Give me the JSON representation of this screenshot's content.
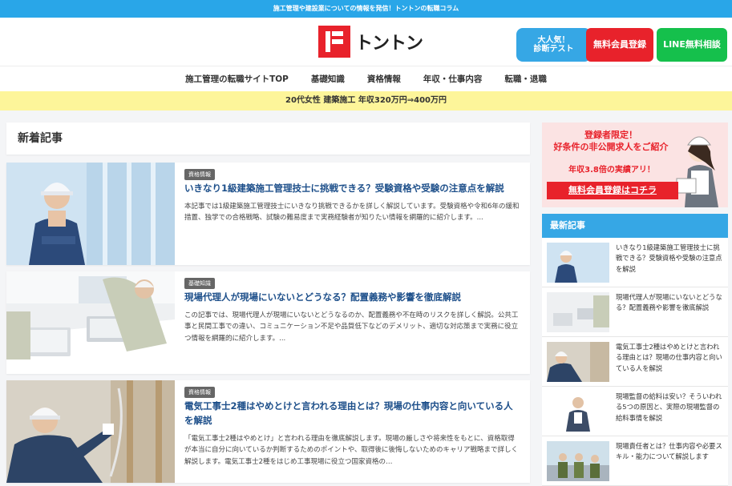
{
  "topbar": {
    "text": "施工管理や建設業についての情報を発信！トントンの転職コラム"
  },
  "header": {
    "logo_text": "トントン",
    "diag_button": "大人気！\n診断テスト",
    "register_button": "無料会員登録",
    "line_button": "LINE無料相談"
  },
  "nav": {
    "items": [
      "施工管理の転職サイトTOP",
      "基礎知識",
      "資格情報",
      "年収・仕事内容",
      "転職・退職"
    ]
  },
  "promo": {
    "text": "20代女性 建築施工 年収320万円⇒400万円"
  },
  "main": {
    "section_title": "新着記事",
    "articles": [
      {
        "badge": "資格情報",
        "title": "いきなり1級建築施工管理技士に挑戦できる？受験資格や受験の注意点を解説",
        "excerpt": "本記事では1級建築施工管理技士にいきなり挑戦できるかを詳しく解説しています。受験資格や令和6年の緩和措置、独学での合格戦略、試験の難易度まで実務経験者が知りたい情報を網羅的に紹介します。..."
      },
      {
        "badge": "基礎知識",
        "title": "現場代理人が現場にいないとどうなる？配置義務や影響を徹底解説",
        "excerpt": "この記事では、現場代理人が現場にいないとどうなるのか、配置義務や不在時のリスクを詳しく解説。公共工事と民間工事での違い、コミュニケーション不足や品質低下などのデメリット、適切な対応策まで実務に役立つ情報を網羅的に紹介します。..."
      },
      {
        "badge": "資格情報",
        "title": "電気工事士2種はやめとけと言われる理由とは？現場の仕事内容と向いている人を解説",
        "excerpt": "「電気工事士2種はやめとけ」と言われる理由を徹底解説します。現場の厳しさや将来性をもとに、資格取得が本当に自分に向いているか判断するためのポイントや、取得後に後悔しないためのキャリア戦略まで詳しく解説します。電気工事士2種をはじめ工事現場に役立つ国家資格の…"
      }
    ]
  },
  "side": {
    "banner": {
      "line1": "登録者限定！\n好条件の非公開求人をご紹介",
      "line2": "年収3.8倍の実績アリ！",
      "line3": "無料会員登録はコチラ"
    },
    "latest_title": "最新記事",
    "latest": [
      "いきなり1級建築施工管理技士に挑戦できる？受験資格や受験の注意点を解説",
      "現場代理人が現場にいないとどうなる？配置義務や影響を徹底解説",
      "電気工事士2種はやめとけと言われる理由とは？現場の仕事内容と向いている人を解説",
      "現場監督の給料は安い？そういわれる5つの原因と、実際の現場監督の給料事情を解説",
      "現場責任者とは？仕事内容や必要スキル・能力について解説します"
    ]
  },
  "colors": {
    "accent_blue": "#29a6e8",
    "brand_red": "#e8222b",
    "line_green": "#15c04c",
    "title_blue": "#1d4f8a"
  }
}
